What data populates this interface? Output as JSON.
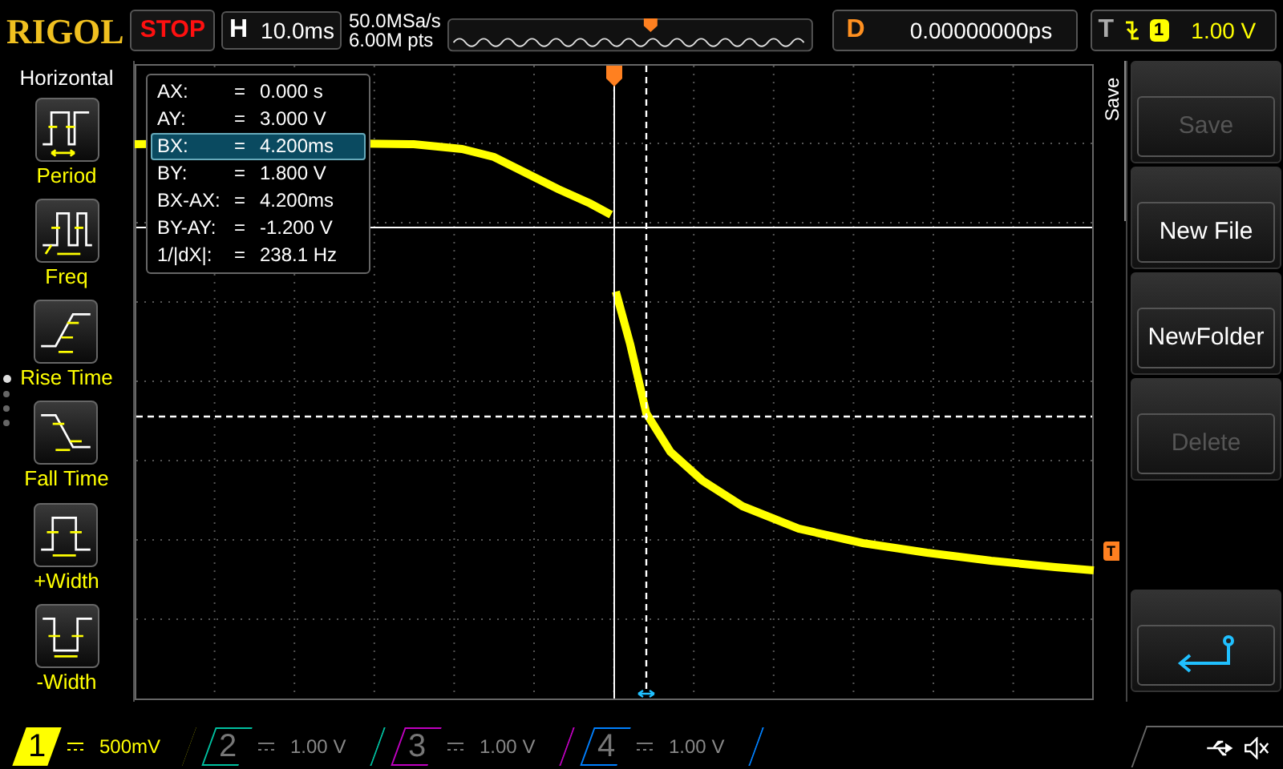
{
  "header": {
    "logo": "RIGOL",
    "run_state": "STOP",
    "timebase": {
      "label": "H",
      "value": "10.0ms"
    },
    "sample_rate": "50.0MSa/s",
    "memory_depth": "6.00M pts",
    "delay": {
      "label": "D",
      "value": "0.00000000ps"
    },
    "trigger": {
      "label": "T",
      "source": "1",
      "level_text": "1.00 V"
    }
  },
  "left_menu": {
    "title": "Horizontal",
    "items": [
      {
        "label": "Period",
        "kind": "period"
      },
      {
        "label": "Freq",
        "kind": "freq"
      },
      {
        "label": "Rise Time",
        "kind": "rise"
      },
      {
        "label": "Fall Time",
        "kind": "fall"
      },
      {
        "label": "+Width",
        "kind": "pwidth"
      },
      {
        "label": "-Width",
        "kind": "nwidth"
      }
    ],
    "pages": [
      {
        "selected": true
      },
      {
        "selected": false
      },
      {
        "selected": false
      },
      {
        "selected": false
      }
    ]
  },
  "cursor_readout": [
    {
      "name": "AX:",
      "eq": "=",
      "value": "0.000 s",
      "selected": false
    },
    {
      "name": "AY:",
      "eq": "=",
      "value": "3.000 V",
      "selected": false
    },
    {
      "name": "BX:",
      "eq": "=",
      "value": "4.200ms",
      "selected": true
    },
    {
      "name": "BY:",
      "eq": "=",
      "value": "1.800 V",
      "selected": false
    },
    {
      "name": "BX-AX:",
      "eq": "=",
      "value": "4.200ms",
      "selected": false
    },
    {
      "name": "BY-AY:",
      "eq": "=",
      "value": "-1.200 V",
      "selected": false
    },
    {
      "name": "1/|dX|:",
      "eq": "=",
      "value": "238.1 Hz",
      "selected": false
    }
  ],
  "right_menu": {
    "title": "Save",
    "buttons": [
      {
        "kind": "text",
        "label": "Save",
        "disabled": true
      },
      {
        "kind": "text",
        "label": "New File",
        "disabled": false
      },
      {
        "kind": "text",
        "label": "NewFolder",
        "disabled": false
      },
      {
        "kind": "text",
        "label": "Delete",
        "disabled": true
      },
      {
        "kind": "empty"
      },
      {
        "kind": "back"
      }
    ]
  },
  "trigger_marker": "T",
  "channels": [
    {
      "number": "1",
      "scale": "500mV",
      "active": true,
      "color": "#ffff00"
    },
    {
      "number": "2",
      "scale": "1.00 V",
      "active": false,
      "color": "#00c0a0"
    },
    {
      "number": "3",
      "scale": "1.00 V",
      "active": false,
      "color": "#c000c0"
    },
    {
      "number": "4",
      "scale": "1.00 V",
      "active": false,
      "color": "#0080ff"
    }
  ]
}
